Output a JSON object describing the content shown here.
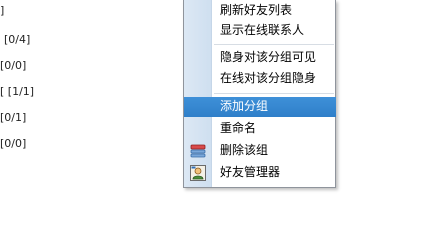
{
  "buddy_list": {
    "group_counts": [
      {
        "text": "]"
      },
      {
        "text": "[0/4]"
      },
      {
        "text": "[0/0]"
      },
      {
        "text": "[  [1/1]"
      },
      {
        "text": "[0/1]"
      },
      {
        "text": "[0/0]"
      }
    ]
  },
  "context_menu": {
    "items": [
      {
        "label": "刷新好友列表"
      },
      {
        "label": "显示在线联系人"
      },
      {
        "label": "隐身对该分组可见"
      },
      {
        "label": "在线对该分组隐身"
      },
      {
        "label": "添加分组",
        "state": "highlighted"
      },
      {
        "label": "重命名"
      },
      {
        "label": "删除该组",
        "icon": "delete-group-icon"
      },
      {
        "label": "好友管理器",
        "icon": "buddy-manager-icon"
      }
    ]
  }
}
